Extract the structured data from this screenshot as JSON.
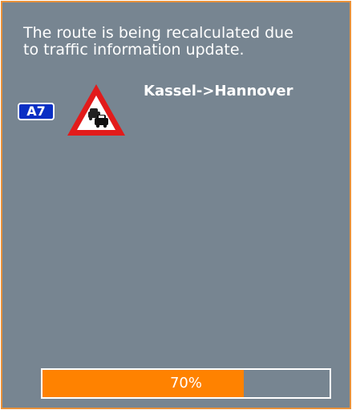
{
  "dialog": {
    "message_lines": [
      "The route is being recalculated due",
      "to traffic information update."
    ],
    "road": {
      "label": "A7",
      "icon": "road-badge-icon"
    },
    "warning_icon": "traffic-jam-warning-icon",
    "route": "Kassel->Hannover",
    "progress": {
      "percent": 70,
      "label": "70%"
    }
  },
  "colors": {
    "background": "#778591",
    "frame_border": "#e8913a",
    "progress_fill": "#ff8200",
    "road_badge": "#0a2fc4",
    "warning_red": "#e21b1b"
  }
}
